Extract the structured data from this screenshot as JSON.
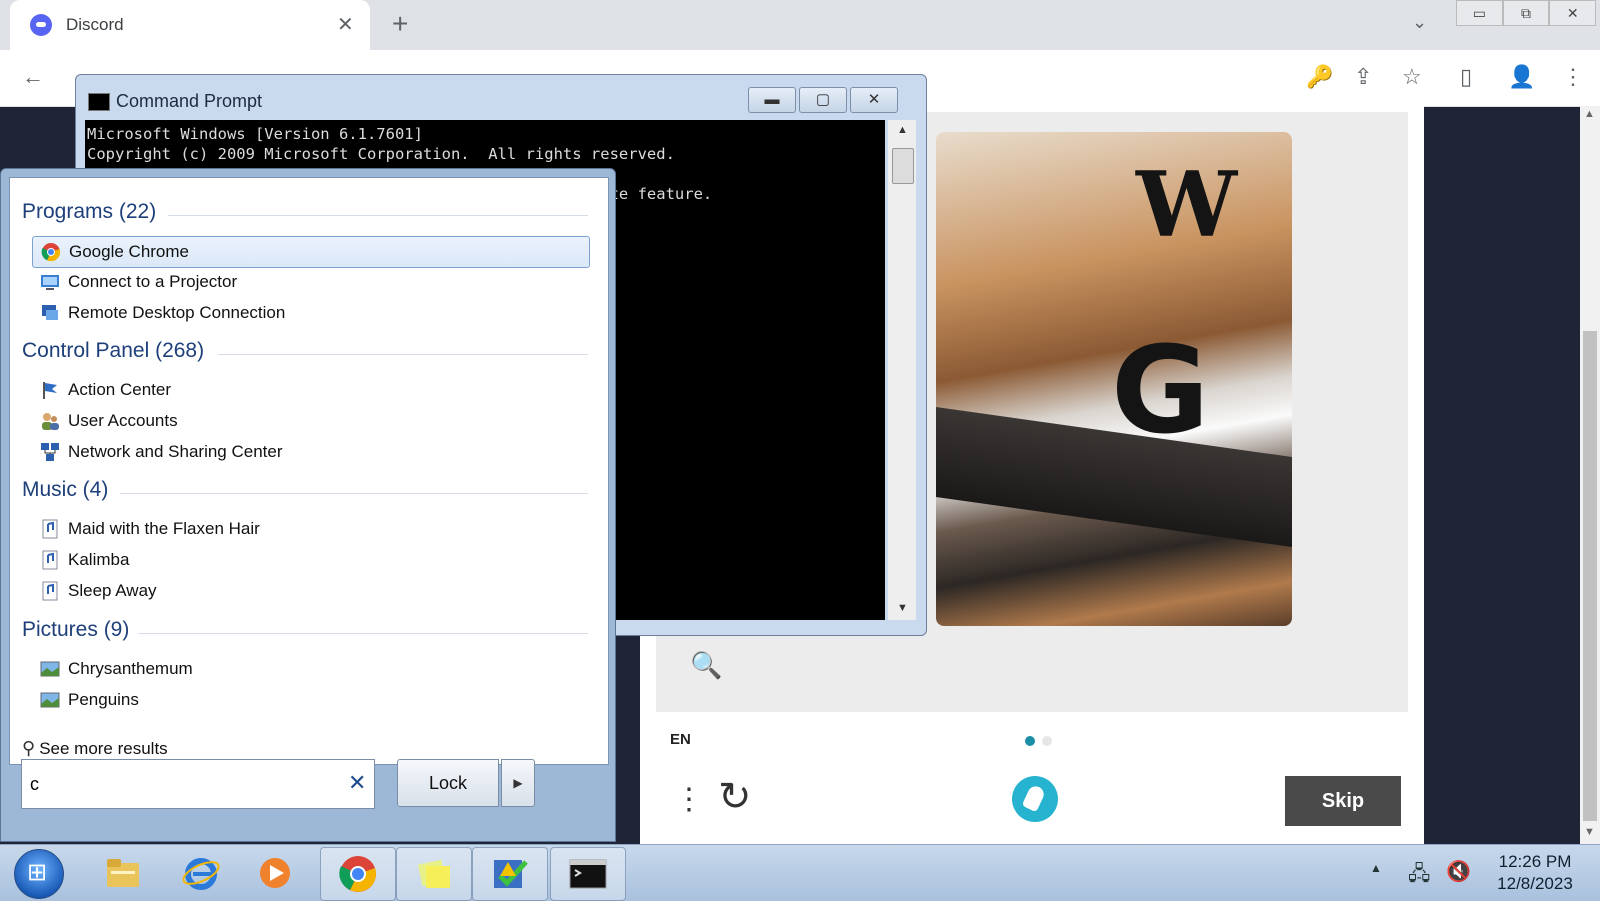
{
  "browser": {
    "tab_title": "Discord",
    "tab_close": "✕",
    "new_tab": "+",
    "tab_dropdown": "⌄",
    "window_buttons": [
      "▭",
      "⧉",
      "✕"
    ],
    "toolbar": {
      "back": "←",
      "icons": [
        "🔑",
        "⇪",
        "☆",
        "▯",
        "👤",
        "⋮"
      ]
    }
  },
  "page": {
    "search_icon": "🔍",
    "language": "EN",
    "menu_icon": "⋮",
    "reload_icon": "↻",
    "skip_label": "Skip"
  },
  "command_prompt": {
    "title": "Command Prompt",
    "lines": [
      "Microsoft Windows [Version 6.1.7601]",
      "Copyright (c) 2009 Microsoft Corporation.  All rights reserved.",
      "",
      "                                                  ibernate feature."
    ],
    "buttons": [
      "▬",
      "▢",
      "✕"
    ]
  },
  "start_menu": {
    "groups": [
      {
        "title": "Programs (22)",
        "items": [
          "Google Chrome",
          "Connect to a Projector",
          "Remote Desktop Connection"
        ]
      },
      {
        "title": "Control Panel (268)",
        "items": [
          "Action Center",
          "User Accounts",
          "Network and Sharing Center"
        ]
      },
      {
        "title": "Music (4)",
        "items": [
          "Maid with the Flaxen Hair",
          "Kalimba",
          "Sleep Away"
        ]
      },
      {
        "title": "Pictures (9)",
        "items": [
          "Chrysanthemum",
          "Penguins"
        ]
      }
    ],
    "see_more": "See more results",
    "search_value": "c",
    "clear_icon": "✕",
    "lock_label": "Lock",
    "lock_arrow": "▶"
  },
  "taskbar": {
    "tray_arrow": "▲",
    "time": "12:26 PM",
    "date": "12/8/2023"
  },
  "colors": {
    "accent": "#1c8fa8",
    "skip_bg": "#4a4a4a",
    "discord": "#5865f2"
  }
}
